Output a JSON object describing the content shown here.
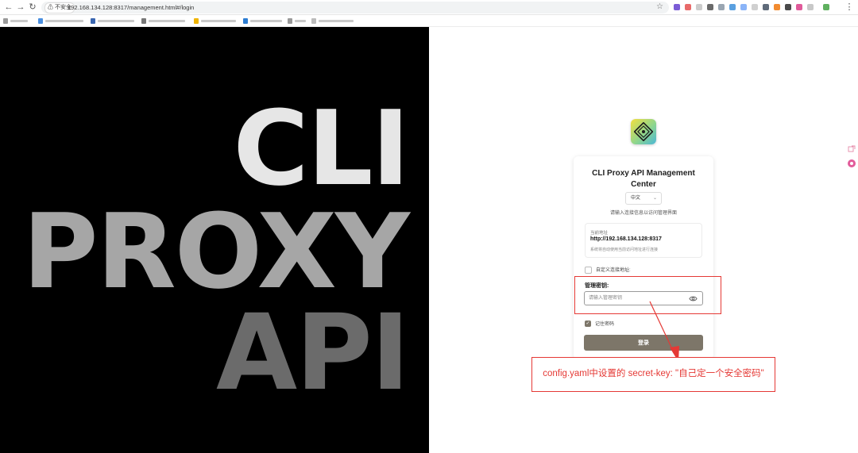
{
  "browser": {
    "security_label": "⚠ 不安全",
    "url": "192.168.134.128:8317/management.html#/login"
  },
  "hero": {
    "line1": "CLI",
    "line2": "PROXY",
    "line3": "API"
  },
  "card": {
    "title_line1": "CLI Proxy API Management",
    "title_line2": "Center",
    "language_selected": "中文",
    "subtitle": "请输入连接信息以访问管理界面",
    "current_address_label": "当前地址",
    "current_address": "http://192.168.134.128:8317",
    "address_hint": "系统将自动使用当前访问地址进行连接",
    "custom_address_label": "自定义连接地址:",
    "key_label": "管理密钥:",
    "key_placeholder": "请输入管理密钥",
    "remember_label": "记住密码",
    "login_button": "登录"
  },
  "annotation": {
    "callout_text": "config.yaml中设置的 secret-key: \"自己定一个安全密码\"",
    "color": "#e53935"
  },
  "theme": {
    "accent": "#7d7669",
    "hero_bg": "#000000"
  }
}
